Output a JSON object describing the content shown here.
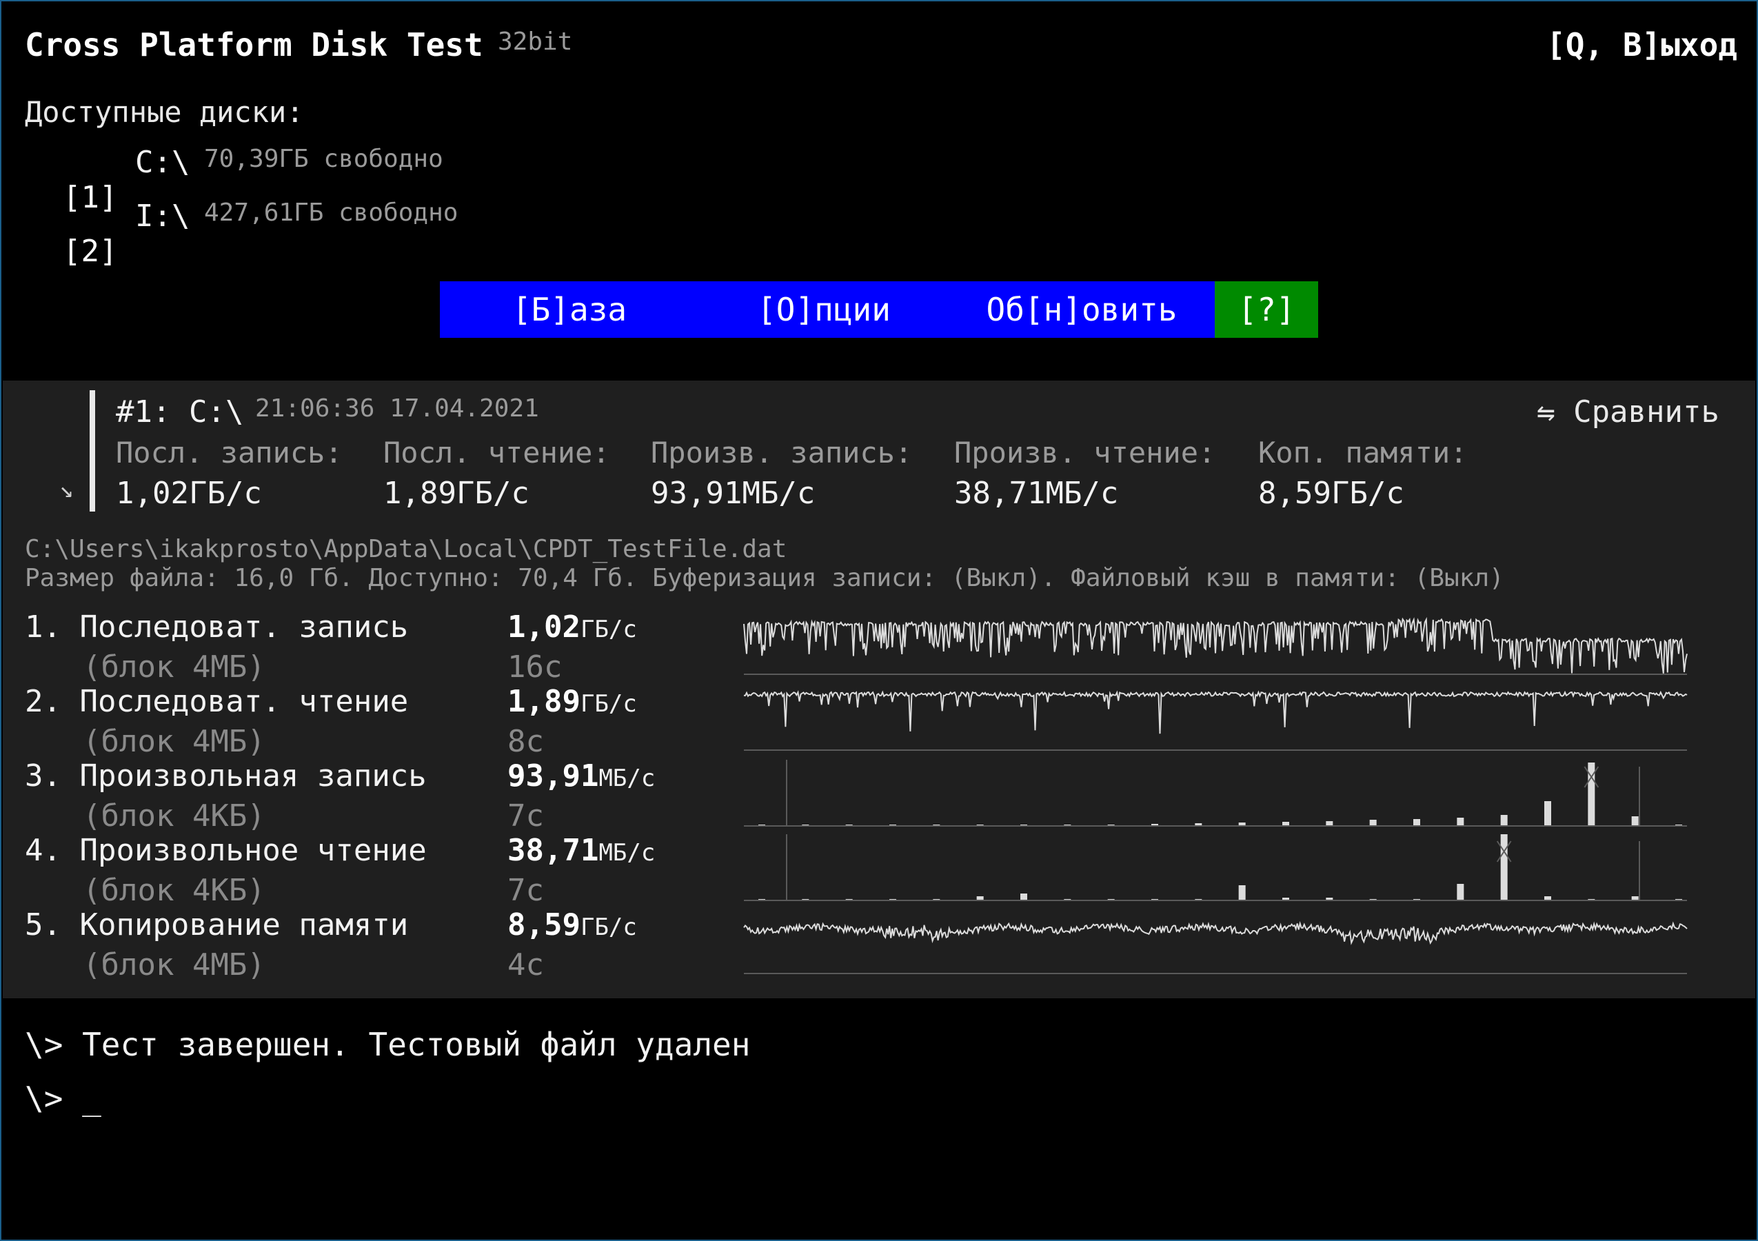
{
  "header": {
    "title": "Cross Platform Disk Test",
    "bits": "32bit",
    "exit_label": "[Q, В]ыход"
  },
  "drives": {
    "title": "Доступные диски:",
    "items": [
      {
        "key": "[1]",
        "letter": "C:\\",
        "free": "70,39ГБ свободно"
      },
      {
        "key": "[2]",
        "letter": "I:\\",
        "free": "427,61ГБ свободно"
      }
    ]
  },
  "menu": {
    "base": "[Б]аза",
    "options": "[О]пции",
    "refresh": "Об[н]овить",
    "help": "[?]"
  },
  "result": {
    "heading": "#1: C:\\",
    "timestamp": "21:06:36 17.04.2021",
    "compare_label": "⇋ Сравнить",
    "collapse_icon": "↘",
    "summary": [
      {
        "label": "Посл. запись:",
        "value": "1,02ГБ/с"
      },
      {
        "label": "Посл. чтение:",
        "value": "1,89ГБ/с"
      },
      {
        "label": "Произв. запись:",
        "value": "93,91МБ/с"
      },
      {
        "label": "Произв. чтение:",
        "value": "38,71МБ/с"
      },
      {
        "label": "Коп. памяти:",
        "value": "8,59ГБ/с"
      }
    ],
    "file_path": "C:\\Users\\ikakprosto\\AppData\\Local\\CPDT_TestFile.dat",
    "file_info": "Размер файла: 16,0 Гб. Доступно: 70,4 Гб. Буферизация записи: (Выкл). Файловый кэш в памяти: (Выкл)",
    "tests": [
      {
        "name": "1. Последоват. запись",
        "block": "(блок 4МБ)",
        "value": "1,02",
        "unit": "ГБ/с",
        "duration": "16с"
      },
      {
        "name": "2. Последоват. чтение",
        "block": "(блок 4МБ)",
        "value": "1,89",
        "unit": "ГБ/с",
        "duration": "8с"
      },
      {
        "name": "3. Произвольная запись",
        "block": "(блок 4КБ)",
        "value": "93,91",
        "unit": "МБ/с",
        "duration": "7с"
      },
      {
        "name": "4. Произвольное чтение",
        "block": "(блок 4КБ)",
        "value": "38,71",
        "unit": "МБ/с",
        "duration": "7с"
      },
      {
        "name": "5. Копирование памяти",
        "block": "(блок 4МБ)",
        "value": "8,59",
        "unit": "ГБ/с",
        "duration": "4с"
      }
    ]
  },
  "console": {
    "prompt": "\\>",
    "lines": [
      "Тест завершен. Тестовый файл удален"
    ],
    "cursor": "_"
  },
  "colors": {
    "background": "#000000",
    "panel": "#1f1f1f",
    "menu_blue": "#0000ff",
    "help_green": "#008a00",
    "frame_border": "#1a5e8a"
  }
}
